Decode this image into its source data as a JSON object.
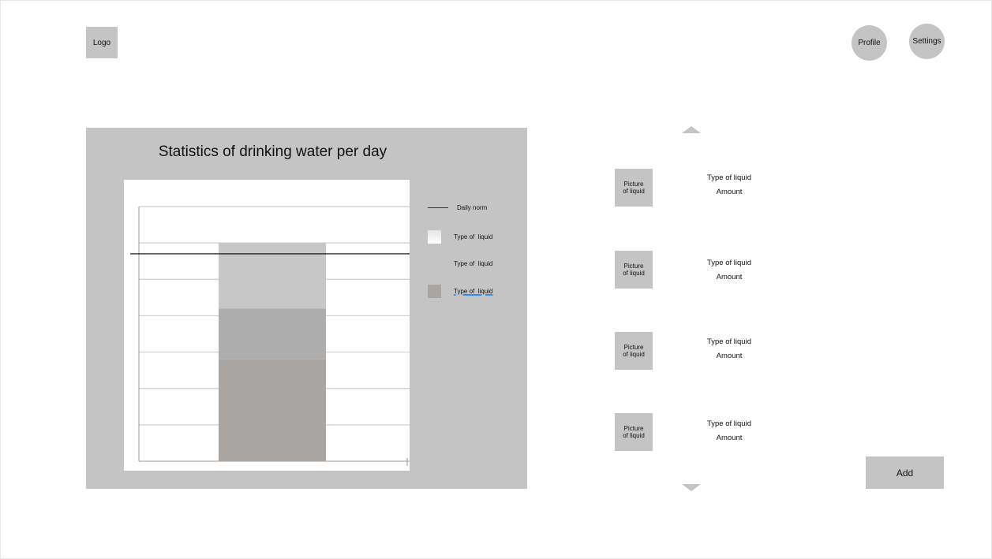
{
  "header": {
    "logo_label": "Logo",
    "profile_label": "Profile",
    "settings_label": "Settings"
  },
  "chart_panel": {
    "title": "Statistics of drinking water per day",
    "legend": [
      {
        "label": "Daily norm",
        "kind": "line",
        "color": "#333333"
      },
      {
        "label": "Type of  liquid",
        "kind": "swatch",
        "color": "#f0f0f0"
      },
      {
        "label": "Type of  liquid",
        "kind": "swatch",
        "color": "#c4c4c4"
      },
      {
        "label": "Type of  liquid",
        "kind": "swatch",
        "color": "#a9a5a3"
      }
    ]
  },
  "chart_data": {
    "type": "bar",
    "stacked": true,
    "categories": [
      ""
    ],
    "series": [
      {
        "name": "Type of  liquid",
        "color": "#a9a5a3",
        "values": [
          2.8
        ]
      },
      {
        "name": "Type of  liquid",
        "color": "#adadad",
        "values": [
          1.4
        ]
      },
      {
        "name": "Type of  liquid",
        "color": "#c7c7c7",
        "values": [
          1.8
        ]
      }
    ],
    "reference_line": {
      "name": "Daily norm",
      "value": 5.7,
      "color": "#000000"
    },
    "ylim": [
      0,
      7
    ],
    "grid": true,
    "legend_position": "right"
  },
  "liquid_list": {
    "items": [
      {
        "picture_label": "Picture\nof liquid",
        "type": "Type of liquid",
        "amount": "Amount"
      },
      {
        "picture_label": "Picture\nof liquid",
        "type": "Type of liquid",
        "amount": "Amount"
      },
      {
        "picture_label": "Picture\nof liquid",
        "type": "Type of liquid",
        "amount": "Amount"
      },
      {
        "picture_label": "Picture\nof liquid",
        "type": "Type of liquid",
        "amount": "Amount"
      }
    ],
    "add_label": "Add"
  }
}
